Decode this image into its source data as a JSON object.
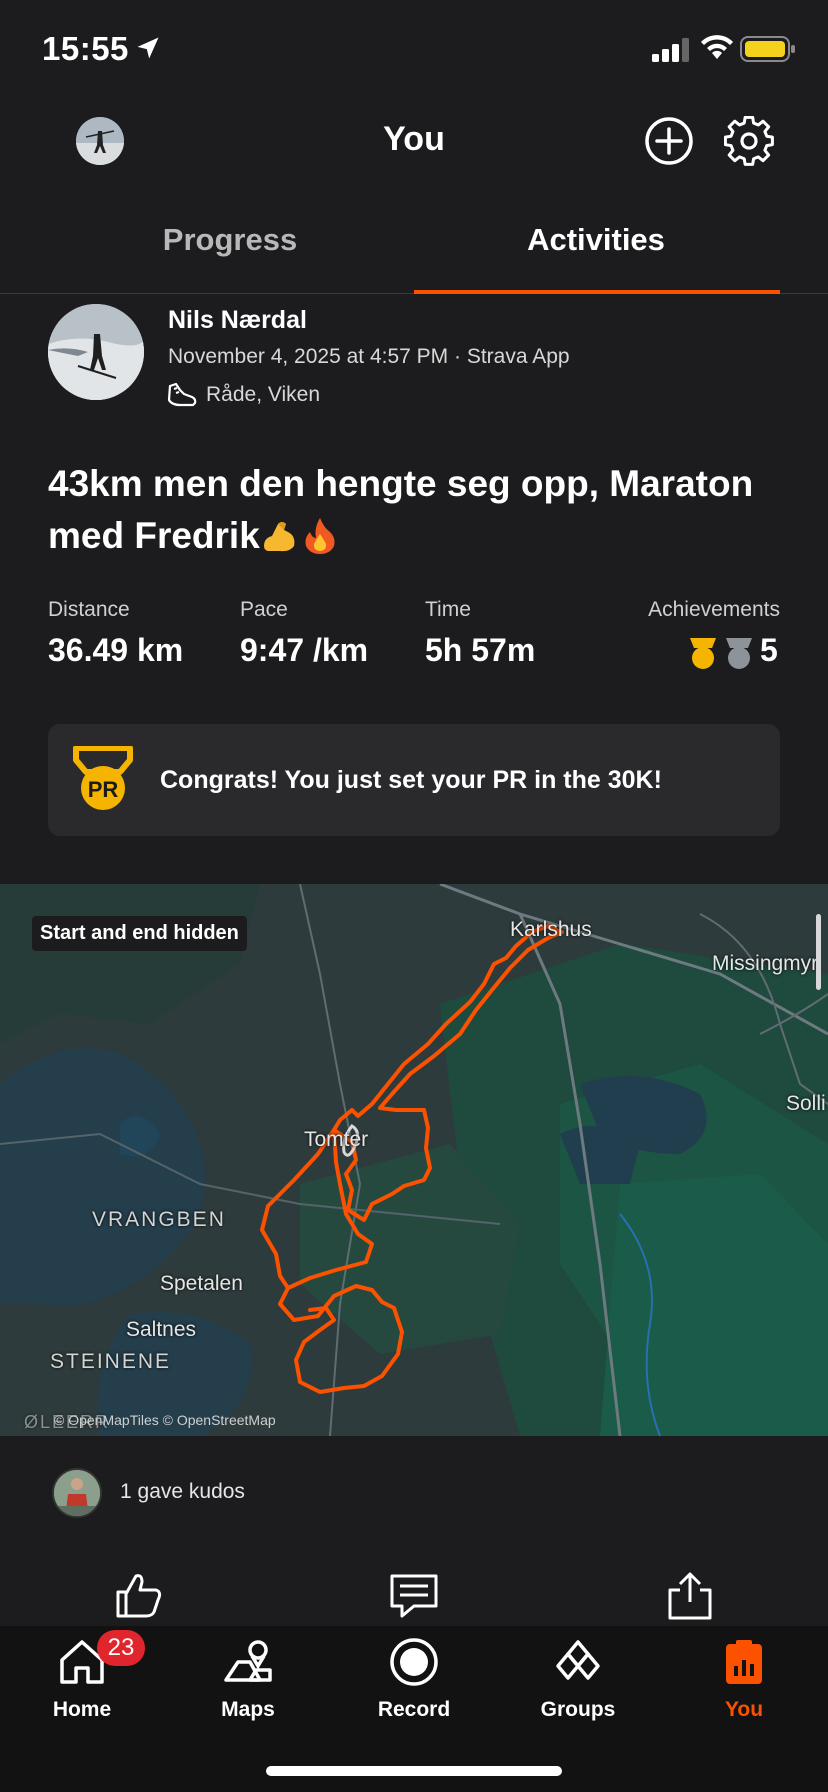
{
  "status_bar": {
    "time": "15:55"
  },
  "header": {
    "title": "You",
    "add_icon": "plus-circle-icon",
    "settings_icon": "gear-icon"
  },
  "tabs": [
    {
      "label": "Progress",
      "active": false
    },
    {
      "label": "Activities",
      "active": true
    }
  ],
  "activity": {
    "athlete": "Nils Nærdal",
    "meta": "November 4, 2025 at 4:57 PM · Strava App",
    "location": "Råde, Viken",
    "title": "43km men den hengte seg opp, Maraton med Fredrik",
    "title_emojis": [
      "flexed-biceps",
      "fire"
    ],
    "stats": [
      {
        "label": "Distance",
        "value": "36.49 km"
      },
      {
        "label": "Pace",
        "value": "9:47 /km"
      },
      {
        "label": "Time",
        "value": "5h 57m"
      }
    ],
    "achievements": {
      "label": "Achievements",
      "count": "5"
    }
  },
  "pr_banner": {
    "icon_text": "PR",
    "text": "Congrats! You just set your PR in the 30K!"
  },
  "map": {
    "badge": "Start and end hidden",
    "labels": {
      "karlshus": "Karlshus",
      "missingmyr": "Missingmyr",
      "solli": "Solli",
      "tomter": "Tomter",
      "vrangben": "VRANGBEN",
      "spetalen": "Spetalen",
      "saltnes": "Saltnes",
      "steinene": "STEINENE",
      "oleerr": "ØLEERR"
    },
    "attribution": "© OpenMapTiles © OpenStreetMap",
    "route_color": "#fc5200"
  },
  "kudos": {
    "text": "1 gave kudos"
  },
  "actions": [
    "like-icon",
    "comment-icon",
    "share-icon"
  ],
  "nav": {
    "home": {
      "label": "Home",
      "badge": "23"
    },
    "maps": {
      "label": "Maps"
    },
    "record": {
      "label": "Record"
    },
    "groups": {
      "label": "Groups"
    },
    "you": {
      "label": "You",
      "active": true
    }
  },
  "colors": {
    "accent": "#fc5200",
    "background": "#1c1c1e",
    "gold": "#f4b400",
    "badge_red": "#e0252c"
  }
}
